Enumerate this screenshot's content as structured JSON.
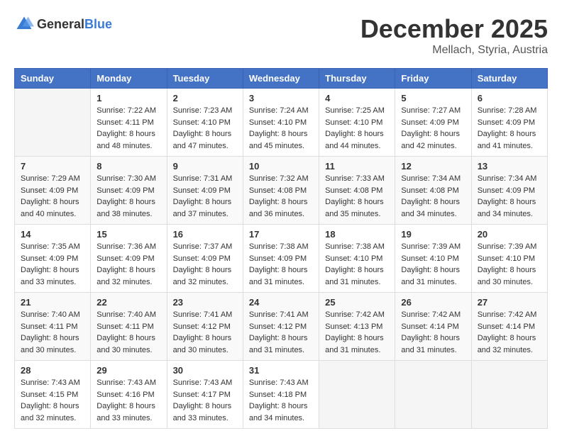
{
  "header": {
    "logo_general": "General",
    "logo_blue": "Blue",
    "month_title": "December 2025",
    "location": "Mellach, Styria, Austria"
  },
  "weekdays": [
    "Sunday",
    "Monday",
    "Tuesday",
    "Wednesday",
    "Thursday",
    "Friday",
    "Saturday"
  ],
  "weeks": [
    [
      {
        "day": "",
        "sunrise": "",
        "sunset": "",
        "daylight": ""
      },
      {
        "day": "1",
        "sunrise": "Sunrise: 7:22 AM",
        "sunset": "Sunset: 4:11 PM",
        "daylight": "Daylight: 8 hours and 48 minutes."
      },
      {
        "day": "2",
        "sunrise": "Sunrise: 7:23 AM",
        "sunset": "Sunset: 4:10 PM",
        "daylight": "Daylight: 8 hours and 47 minutes."
      },
      {
        "day": "3",
        "sunrise": "Sunrise: 7:24 AM",
        "sunset": "Sunset: 4:10 PM",
        "daylight": "Daylight: 8 hours and 45 minutes."
      },
      {
        "day": "4",
        "sunrise": "Sunrise: 7:25 AM",
        "sunset": "Sunset: 4:10 PM",
        "daylight": "Daylight: 8 hours and 44 minutes."
      },
      {
        "day": "5",
        "sunrise": "Sunrise: 7:27 AM",
        "sunset": "Sunset: 4:09 PM",
        "daylight": "Daylight: 8 hours and 42 minutes."
      },
      {
        "day": "6",
        "sunrise": "Sunrise: 7:28 AM",
        "sunset": "Sunset: 4:09 PM",
        "daylight": "Daylight: 8 hours and 41 minutes."
      }
    ],
    [
      {
        "day": "7",
        "sunrise": "Sunrise: 7:29 AM",
        "sunset": "Sunset: 4:09 PM",
        "daylight": "Daylight: 8 hours and 40 minutes."
      },
      {
        "day": "8",
        "sunrise": "Sunrise: 7:30 AM",
        "sunset": "Sunset: 4:09 PM",
        "daylight": "Daylight: 8 hours and 38 minutes."
      },
      {
        "day": "9",
        "sunrise": "Sunrise: 7:31 AM",
        "sunset": "Sunset: 4:09 PM",
        "daylight": "Daylight: 8 hours and 37 minutes."
      },
      {
        "day": "10",
        "sunrise": "Sunrise: 7:32 AM",
        "sunset": "Sunset: 4:08 PM",
        "daylight": "Daylight: 8 hours and 36 minutes."
      },
      {
        "day": "11",
        "sunrise": "Sunrise: 7:33 AM",
        "sunset": "Sunset: 4:08 PM",
        "daylight": "Daylight: 8 hours and 35 minutes."
      },
      {
        "day": "12",
        "sunrise": "Sunrise: 7:34 AM",
        "sunset": "Sunset: 4:08 PM",
        "daylight": "Daylight: 8 hours and 34 minutes."
      },
      {
        "day": "13",
        "sunrise": "Sunrise: 7:34 AM",
        "sunset": "Sunset: 4:09 PM",
        "daylight": "Daylight: 8 hours and 34 minutes."
      }
    ],
    [
      {
        "day": "14",
        "sunrise": "Sunrise: 7:35 AM",
        "sunset": "Sunset: 4:09 PM",
        "daylight": "Daylight: 8 hours and 33 minutes."
      },
      {
        "day": "15",
        "sunrise": "Sunrise: 7:36 AM",
        "sunset": "Sunset: 4:09 PM",
        "daylight": "Daylight: 8 hours and 32 minutes."
      },
      {
        "day": "16",
        "sunrise": "Sunrise: 7:37 AM",
        "sunset": "Sunset: 4:09 PM",
        "daylight": "Daylight: 8 hours and 32 minutes."
      },
      {
        "day": "17",
        "sunrise": "Sunrise: 7:38 AM",
        "sunset": "Sunset: 4:09 PM",
        "daylight": "Daylight: 8 hours and 31 minutes."
      },
      {
        "day": "18",
        "sunrise": "Sunrise: 7:38 AM",
        "sunset": "Sunset: 4:10 PM",
        "daylight": "Daylight: 8 hours and 31 minutes."
      },
      {
        "day": "19",
        "sunrise": "Sunrise: 7:39 AM",
        "sunset": "Sunset: 4:10 PM",
        "daylight": "Daylight: 8 hours and 31 minutes."
      },
      {
        "day": "20",
        "sunrise": "Sunrise: 7:39 AM",
        "sunset": "Sunset: 4:10 PM",
        "daylight": "Daylight: 8 hours and 30 minutes."
      }
    ],
    [
      {
        "day": "21",
        "sunrise": "Sunrise: 7:40 AM",
        "sunset": "Sunset: 4:11 PM",
        "daylight": "Daylight: 8 hours and 30 minutes."
      },
      {
        "day": "22",
        "sunrise": "Sunrise: 7:40 AM",
        "sunset": "Sunset: 4:11 PM",
        "daylight": "Daylight: 8 hours and 30 minutes."
      },
      {
        "day": "23",
        "sunrise": "Sunrise: 7:41 AM",
        "sunset": "Sunset: 4:12 PM",
        "daylight": "Daylight: 8 hours and 30 minutes."
      },
      {
        "day": "24",
        "sunrise": "Sunrise: 7:41 AM",
        "sunset": "Sunset: 4:12 PM",
        "daylight": "Daylight: 8 hours and 31 minutes."
      },
      {
        "day": "25",
        "sunrise": "Sunrise: 7:42 AM",
        "sunset": "Sunset: 4:13 PM",
        "daylight": "Daylight: 8 hours and 31 minutes."
      },
      {
        "day": "26",
        "sunrise": "Sunrise: 7:42 AM",
        "sunset": "Sunset: 4:14 PM",
        "daylight": "Daylight: 8 hours and 31 minutes."
      },
      {
        "day": "27",
        "sunrise": "Sunrise: 7:42 AM",
        "sunset": "Sunset: 4:14 PM",
        "daylight": "Daylight: 8 hours and 32 minutes."
      }
    ],
    [
      {
        "day": "28",
        "sunrise": "Sunrise: 7:43 AM",
        "sunset": "Sunset: 4:15 PM",
        "daylight": "Daylight: 8 hours and 32 minutes."
      },
      {
        "day": "29",
        "sunrise": "Sunrise: 7:43 AM",
        "sunset": "Sunset: 4:16 PM",
        "daylight": "Daylight: 8 hours and 33 minutes."
      },
      {
        "day": "30",
        "sunrise": "Sunrise: 7:43 AM",
        "sunset": "Sunset: 4:17 PM",
        "daylight": "Daylight: 8 hours and 33 minutes."
      },
      {
        "day": "31",
        "sunrise": "Sunrise: 7:43 AM",
        "sunset": "Sunset: 4:18 PM",
        "daylight": "Daylight: 8 hours and 34 minutes."
      },
      {
        "day": "",
        "sunrise": "",
        "sunset": "",
        "daylight": ""
      },
      {
        "day": "",
        "sunrise": "",
        "sunset": "",
        "daylight": ""
      },
      {
        "day": "",
        "sunrise": "",
        "sunset": "",
        "daylight": ""
      }
    ]
  ]
}
